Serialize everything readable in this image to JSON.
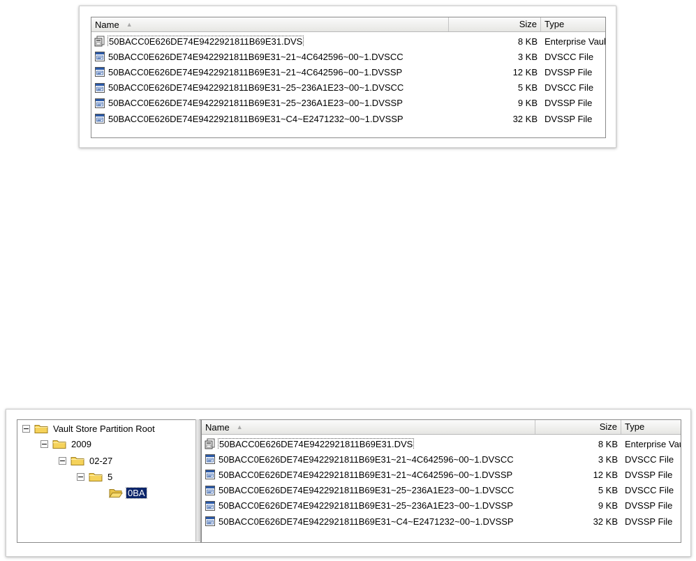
{
  "columns": {
    "name": "Name",
    "size": "Size",
    "type": "Type"
  },
  "files": [
    {
      "name": "50BACC0E626DE74E9422921811B69E31.DVS",
      "size": "8 KB",
      "type": "Enterprise Vault",
      "icon": "dvs-saveset-icon",
      "selected": true
    },
    {
      "name": "50BACC0E626DE74E9422921811B69E31~21~4C642596~00~1.DVSCC",
      "size": "3 KB",
      "type": "DVSCC File",
      "icon": "dvscc-file-icon",
      "selected": false
    },
    {
      "name": "50BACC0E626DE74E9422921811B69E31~21~4C642596~00~1.DVSSP",
      "size": "12 KB",
      "type": "DVSSP File",
      "icon": "dvssp-file-icon",
      "selected": false
    },
    {
      "name": "50BACC0E626DE74E9422921811B69E31~25~236A1E23~00~1.DVSCC",
      "size": "5 KB",
      "type": "DVSCC File",
      "icon": "dvscc-file-icon",
      "selected": false
    },
    {
      "name": "50BACC0E626DE74E9422921811B69E31~25~236A1E23~00~1.DVSSP",
      "size": "9 KB",
      "type": "DVSSP File",
      "icon": "dvssp-file-icon",
      "selected": false
    },
    {
      "name": "50BACC0E626DE74E9422921811B69E31~C4~E2471232~00~1.DVSSP",
      "size": "32 KB",
      "type": "DVSSP File",
      "icon": "dvssp-file-icon",
      "selected": false
    }
  ],
  "tree": [
    {
      "label": "Vault Store Partition Root",
      "expanded": true,
      "level": 0
    },
    {
      "label": "2009",
      "expanded": true,
      "level": 1
    },
    {
      "label": "02-27",
      "expanded": true,
      "level": 2
    },
    {
      "label": "5",
      "expanded": true,
      "level": 3
    },
    {
      "label": "0BA",
      "expanded": false,
      "level": 4,
      "selected": true
    }
  ],
  "colors": {
    "selection": "#0a246a",
    "folder": "#f5d25a",
    "file_icon_blue": "#2b5aa8"
  }
}
